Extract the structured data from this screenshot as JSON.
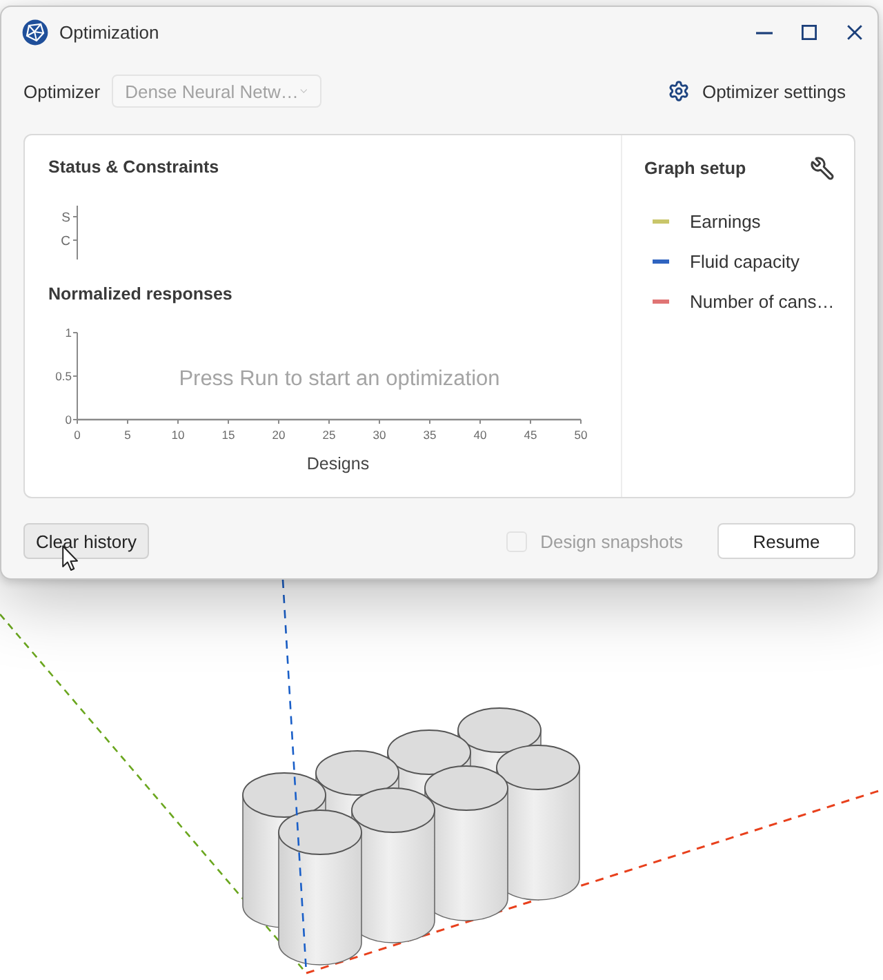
{
  "window": {
    "title": "Optimization"
  },
  "optimizer": {
    "label": "Optimizer",
    "dropdown": {
      "value": "Dense Neural Netw…",
      "disabled": true
    },
    "settings_button": "Optimizer settings"
  },
  "status_constraints": {
    "title": "Status & Constraints",
    "row_labels": [
      "S",
      "C"
    ]
  },
  "normalized_responses": {
    "title": "Normalized responses",
    "empty_message": "Press Run to start an optimization",
    "chart_data": {
      "type": "line",
      "xlabel": "Designs",
      "xlim": [
        0,
        50
      ],
      "ylim": [
        0,
        1
      ],
      "xticks": [
        0,
        5,
        10,
        15,
        20,
        25,
        30,
        35,
        40,
        45,
        50
      ],
      "yticks": [
        0,
        0.5,
        1
      ]
    }
  },
  "graph_setup": {
    "title": "Graph setup",
    "legend": [
      {
        "label": "Earnings",
        "color": "#c9c66a"
      },
      {
        "label": "Fluid capacity",
        "color": "#2f64c0"
      },
      {
        "label": "Number of cans…",
        "color": "#e07474"
      }
    ]
  },
  "footer": {
    "clear_button": {
      "label": "Clear history",
      "hovered": true
    },
    "snapshots": {
      "label": "Design snapshots",
      "checked": false,
      "disabled": true
    },
    "resume_button": {
      "label": "Resume",
      "hovered": false
    }
  }
}
